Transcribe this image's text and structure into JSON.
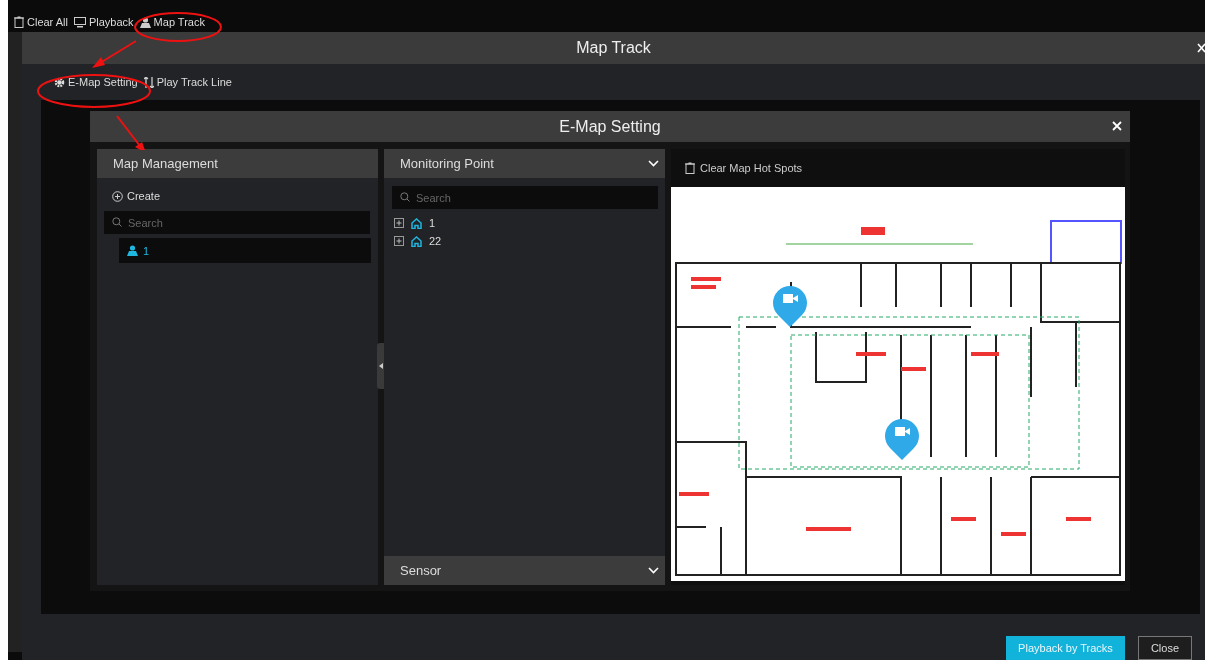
{
  "top_toolbar": [
    {
      "label": "Clear All",
      "kind": "trash"
    },
    {
      "label": "Playback",
      "kind": "monitor"
    },
    {
      "label": "Map Track",
      "kind": "map"
    }
  ],
  "map_track": {
    "title": "Map Track",
    "tools": [
      {
        "label": "E-Map Setting",
        "kind": "gear"
      },
      {
        "label": "Play Track Line",
        "kind": "track"
      }
    ],
    "buttons": [
      {
        "label": "Playback by Tracks",
        "kind": "primary"
      },
      {
        "label": "Close",
        "kind": "secondary"
      }
    ]
  },
  "emap_setting": {
    "title": "E-Map Setting",
    "map_management": {
      "title": "Map Management",
      "create_label": "Create",
      "search_placeholder": "Search",
      "maps": [
        {
          "label": "1",
          "selected": true
        }
      ]
    },
    "monitoring_point": {
      "title": "Monitoring Point",
      "search_placeholder": "Search",
      "nodes": [
        {
          "label": "1",
          "expanded": false
        },
        {
          "label": "22",
          "expanded": false
        }
      ]
    },
    "sensor": {
      "title": "Sensor"
    },
    "map_panel": {
      "clear_label": "Clear Map Hot Spots"
    }
  }
}
